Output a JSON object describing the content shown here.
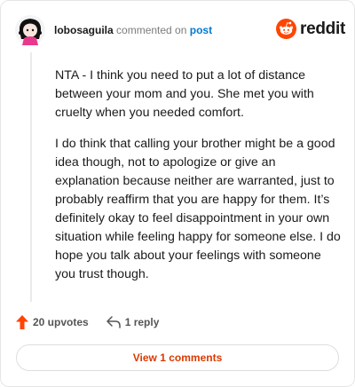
{
  "comment": {
    "username": "lobosaguila",
    "action_text": "commented on",
    "post_link": "post",
    "paragraphs": [
      "NTA - I think you need to put a lot of distance between your mom and you. She met you with cruelty when you needed comfort.",
      "I do think that calling your brother might be a good idea though, not to apologize or give an explanation because neither are warranted, just to probably reaffirm that you are happy for them. It’s definitely okay to feel disappointment in your own situation while feeling happy for someone else. I do hope you talk about your feelings with someone you trust though."
    ]
  },
  "brand": {
    "name": "reddit",
    "color": "#ff4500"
  },
  "actions": {
    "upvotes_label": "20 upvotes",
    "upvote_icon": "arrow-up-icon",
    "replies_label": "1 reply",
    "reply_icon": "reply-icon"
  },
  "view_comments_label": "View 1 comments",
  "colors": {
    "upvote": "#ff4500",
    "link": "#0079d3",
    "view_button_text": "#d93a00"
  }
}
